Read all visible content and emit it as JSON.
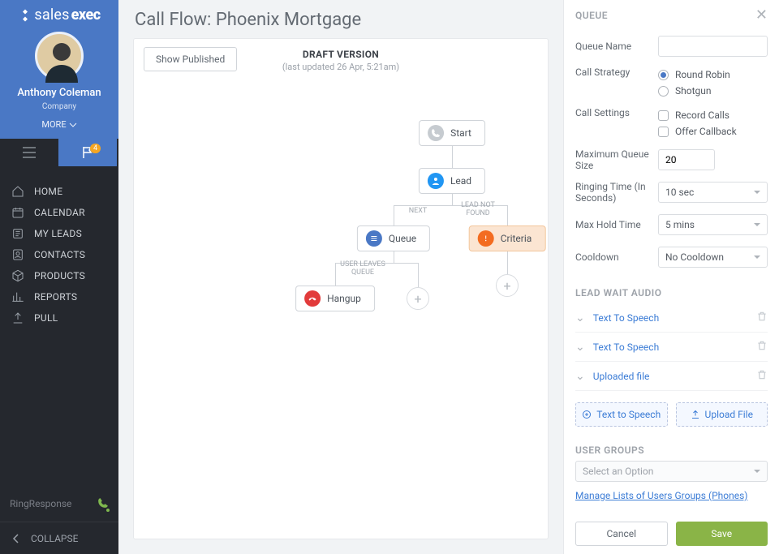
{
  "brand": {
    "name_prefix": "sales",
    "name_bold": "exec"
  },
  "profile": {
    "username": "Anthony Coleman",
    "company": "Company",
    "more": "MORE"
  },
  "nav_badge": "4",
  "nav": [
    {
      "label": "HOME"
    },
    {
      "label": "CALENDAR"
    },
    {
      "label": "MY LEADS"
    },
    {
      "label": "CONTACTS"
    },
    {
      "label": "PRODUCTS"
    },
    {
      "label": "REPORTS"
    },
    {
      "label": "PULL"
    }
  ],
  "footer": {
    "brand": "RingResponse",
    "collapse": "COLLAPSE"
  },
  "page": {
    "title": "Call Flow: Phoenix Mortgage",
    "show_published": "Show Published",
    "draft_title": "DRAFT VERSION",
    "draft_sub": "(last updated 26 Apr, 5:21am)"
  },
  "flow": {
    "start": "Start",
    "lead": "Lead",
    "queue": "Queue",
    "criteria": "Criteria",
    "hangup": "Hangup",
    "edge_next": "NEXT",
    "edge_notfound": "LEAD NOT\nFOUND",
    "edge_userleaves": "USER LEAVES\nQUEUE"
  },
  "panel": {
    "title": "QUEUE",
    "queue_name_label": "Queue Name",
    "queue_name_value": "",
    "strategy_label": "Call Strategy",
    "strategy_options": {
      "rr": "Round Robin",
      "shotgun": "Shotgun"
    },
    "settings_label": "Call Settings",
    "settings_options": {
      "record": "Record Calls",
      "callback": "Offer Callback"
    },
    "max_queue_label": "Maximum Queue Size",
    "max_queue_value": "20",
    "ringing_label": "Ringing Time (In Seconds)",
    "ringing_value": "10 sec",
    "hold_label": "Max Hold Time",
    "hold_value": "5 mins",
    "cooldown_label": "Cooldown",
    "cooldown_value": "No Cooldown",
    "wait_audio_title": "LEAD WAIT AUDIO",
    "audio_items": [
      {
        "label": "Text To Speech"
      },
      {
        "label": "Text To Speech"
      },
      {
        "label": "Uploaded file"
      }
    ],
    "tts_btn": "Text to Speech",
    "upload_btn": "Upload File",
    "groups_title": "USER GROUPS",
    "groups_placeholder": "Select an Option",
    "groups_link": "Manage Lists of Users Groups (Phones)",
    "cancel": "Cancel",
    "save": "Save"
  }
}
